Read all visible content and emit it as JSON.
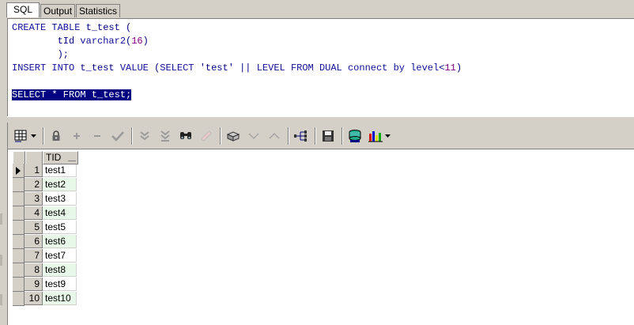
{
  "tabs": [
    {
      "label": "SQL",
      "active": true
    },
    {
      "label": "Output",
      "active": false
    },
    {
      "label": "Statistics",
      "active": false
    }
  ],
  "editor": {
    "line1": {
      "kw1": "CREATE TABLE",
      "name": "t_test",
      "paren": "("
    },
    "line2": {
      "col": "tId",
      "type": "varchar2",
      "size_open": "(",
      "size": "16",
      "size_close": ")"
    },
    "line3": {
      "text": ");"
    },
    "line4": {
      "kw1": "INSERT INTO",
      "name": "t_test",
      "kw2": "VALUE",
      "p": "(",
      "kw3": "SELECT",
      "str": "'test'",
      "op": "||",
      "kw4": "LEVEL",
      "kw5": "FROM",
      "kw6": "DUAL",
      "kw7": "connect by",
      "lvl": "level",
      "lt": "<",
      "num": "11",
      "pc": ")"
    },
    "line6": "SELECT * FROM t_test;"
  },
  "toolbar_icons": [
    "grid-layout-icon",
    "lock-icon",
    "add-record-icon",
    "delete-record-icon",
    "post-record-icon",
    "fetch-next-icon",
    "fetch-last-icon",
    "find-icon",
    "clear-icon",
    "query-by-example-icon",
    "previous-icon",
    "next-icon",
    "explain-plan-icon",
    "save-icon",
    "export-icon",
    "chart-icon"
  ],
  "grid": {
    "column_header": "TID",
    "rows": [
      {
        "num": "1",
        "val": "test1"
      },
      {
        "num": "2",
        "val": "test2"
      },
      {
        "num": "3",
        "val": "test3"
      },
      {
        "num": "4",
        "val": "test4"
      },
      {
        "num": "5",
        "val": "test5"
      },
      {
        "num": "6",
        "val": "test6"
      },
      {
        "num": "7",
        "val": "test7"
      },
      {
        "num": "8",
        "val": "test8"
      },
      {
        "num": "9",
        "val": "test9"
      },
      {
        "num": "10",
        "val": "test10"
      }
    ]
  },
  "colors": {
    "keyword": "#0f0f99",
    "selection": "#000080",
    "alt_row": "#e8f8e8",
    "number": "#800080"
  }
}
